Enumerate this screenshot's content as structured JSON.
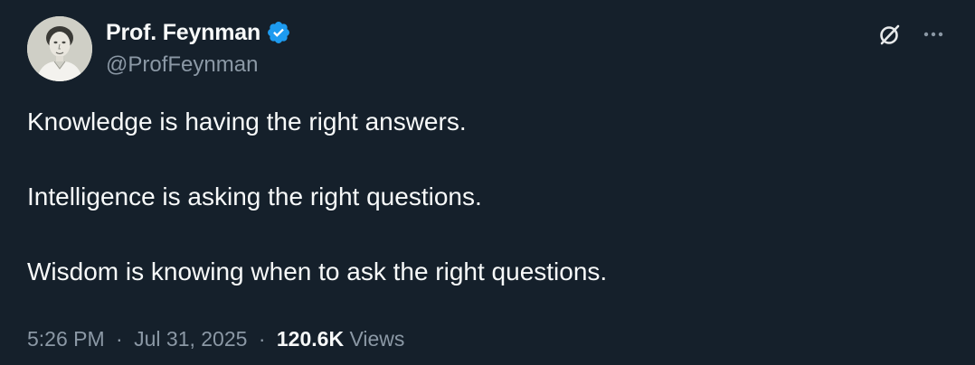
{
  "author": {
    "display_name": "Prof. Feynman",
    "handle": "@ProfFeynman",
    "verified": true,
    "avatar_icon": "portrait-avatar"
  },
  "tweet": {
    "lines": [
      "Knowledge is having the right answers.",
      "Intelligence is asking the right questions.",
      "Wisdom is knowing when to ask the right questions."
    ]
  },
  "meta": {
    "time": "5:26 PM",
    "separator": "·",
    "date": "Jul 31, 2025",
    "views_count": "120.6K",
    "views_label": "Views"
  },
  "actions": {
    "grok_icon": "grok-icon",
    "more_icon": "more-options-icon"
  },
  "colors": {
    "background": "#15202b",
    "primary_text": "#f7f9f9",
    "secondary_text": "#8b98a5",
    "verified_blue": "#1d9bf0"
  }
}
